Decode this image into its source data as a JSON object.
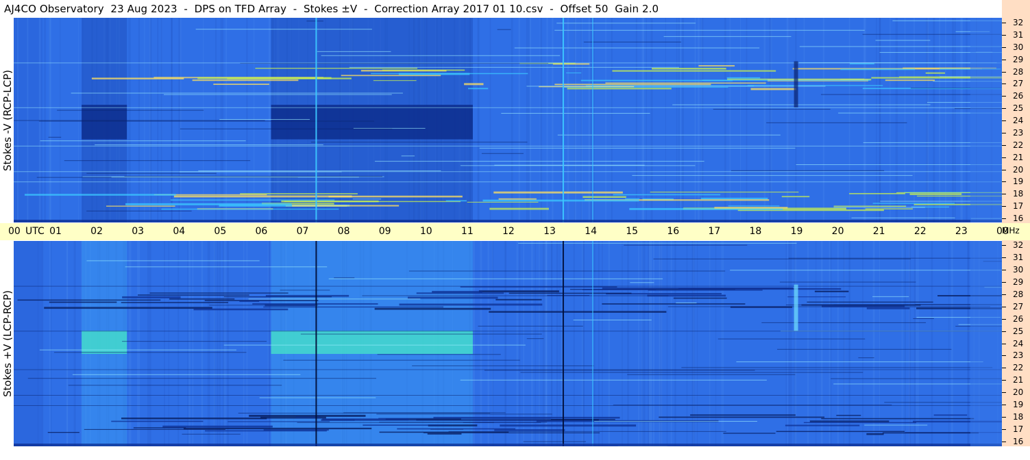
{
  "title": "AJ4CO Observatory  23 Aug 2023  -  DPS on TFD Array  -  Stokes ±V  -  Correction Array 2017 01 10.csv  -  Offset 50  Gain 2.0",
  "panels": {
    "top_label": "Stokes -V (RCP-LCP)",
    "bottom_label": "Stokes +V (LCP-RCP)"
  },
  "time_axis": {
    "labels": [
      "00",
      "01",
      "02",
      "03",
      "04",
      "05",
      "06",
      "07",
      "08",
      "09",
      "10",
      "11",
      "12",
      "13",
      "14",
      "15",
      "16",
      "17",
      "18",
      "19",
      "20",
      "21",
      "22",
      "23",
      "00"
    ],
    "unit": "UTC"
  },
  "freq_axis": {
    "labels": [
      "32",
      "31",
      "30",
      "29",
      "28",
      "27",
      "26",
      "25",
      "24",
      "23",
      "22",
      "21",
      "20",
      "19",
      "18",
      "17",
      "16"
    ],
    "unit": "MHz"
  },
  "colors": {
    "base": "#2f6fe6",
    "dark": "#0b2a8a",
    "bright": "#3cc8ff",
    "hot": "#c8f050",
    "axis_time_bg": "#ffffc6",
    "axis_freq_bg": "#ffdec4"
  },
  "chart_data": [
    {
      "type": "heatmap",
      "title": "Stokes -V (RCP-LCP)",
      "xlabel": "UTC",
      "ylabel": "MHz",
      "xlim": [
        0,
        24
      ],
      "ylim": [
        16,
        32
      ],
      "dark_bands_utc": [
        [
          1.65,
          2.75
        ],
        [
          6.25,
          11.15
        ]
      ],
      "dark_band_freq_mhz": [
        22.5,
        25.2
      ],
      "vertical_lines_utc": [
        7.33,
        13.33,
        14.05
      ],
      "activity_bands_mhz": [
        [
          17,
          18.5
        ],
        [
          26.5,
          28.5
        ]
      ]
    },
    {
      "type": "heatmap",
      "title": "Stokes +V (LCP-RCP)",
      "xlabel": "UTC",
      "ylabel": "MHz",
      "xlim": [
        0,
        24
      ],
      "ylim": [
        16,
        32
      ],
      "bright_bands_utc": [
        [
          1.65,
          2.75
        ],
        [
          6.25,
          11.15
        ]
      ],
      "bright_band_freq_mhz": [
        23.2,
        25.0
      ],
      "vertical_lines_utc": [
        7.33,
        13.33,
        14.05
      ],
      "activity_bands_mhz": [
        [
          17,
          18.5
        ],
        [
          26.5,
          28.5
        ]
      ]
    }
  ]
}
